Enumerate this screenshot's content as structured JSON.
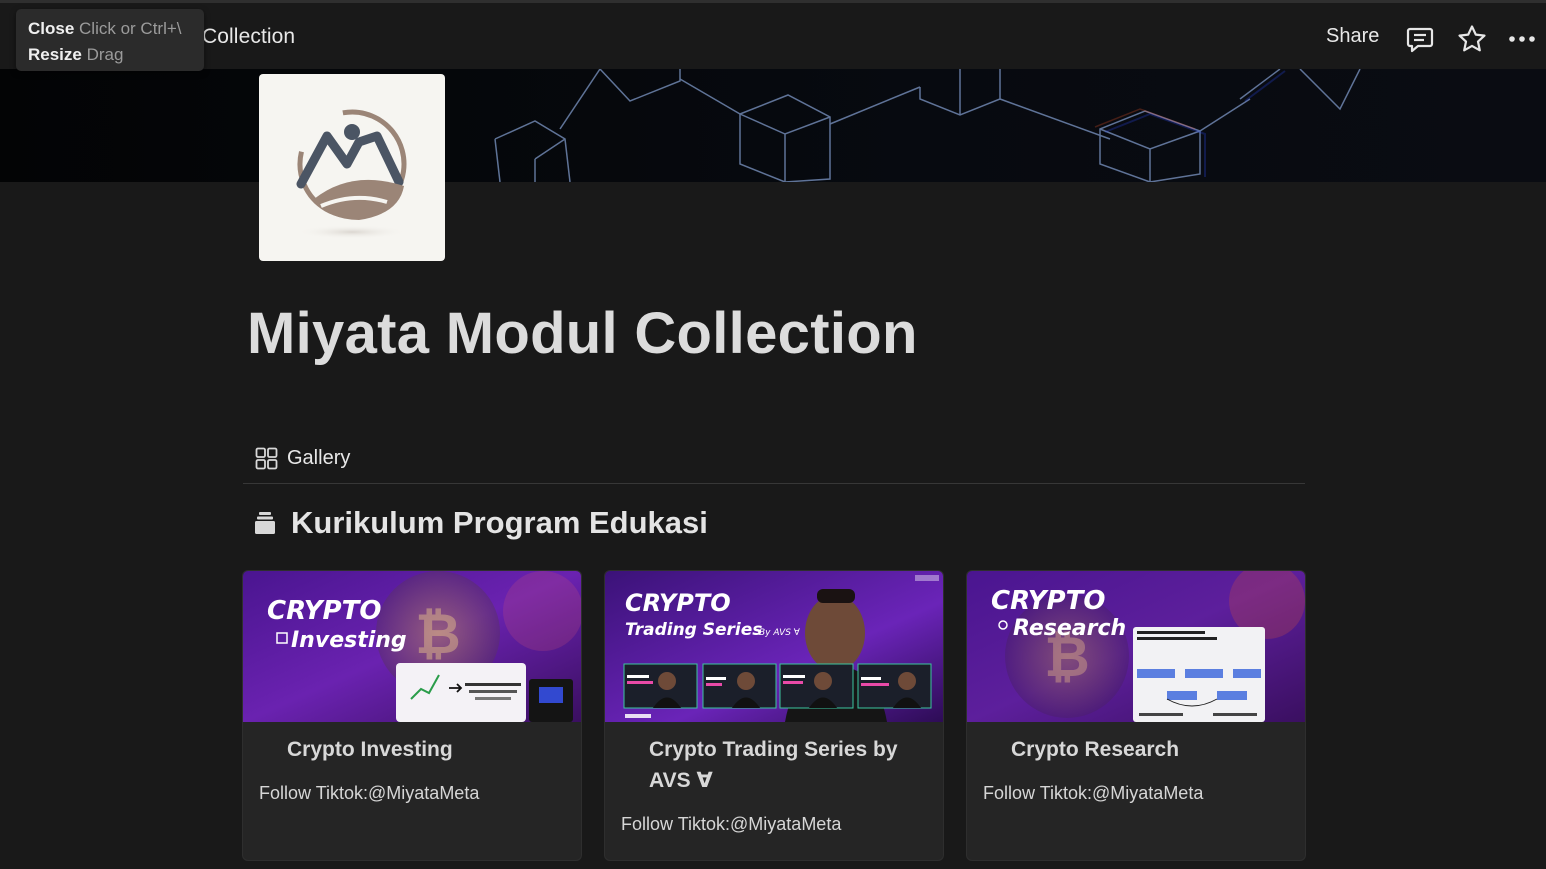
{
  "tooltip": {
    "close_key": "Close",
    "close_hint": "Click or Ctrl+\\",
    "resize_key": "Resize",
    "resize_hint": "Drag"
  },
  "topbar": {
    "breadcrumb_title": "Collection",
    "share_label": "Share",
    "icons": [
      "comment-icon",
      "star-icon",
      "more-icon"
    ]
  },
  "page": {
    "title": "Miyata Modul Collection"
  },
  "view": {
    "tab_label": "Gallery"
  },
  "group": {
    "heading": "Kurikulum Program Edukasi"
  },
  "cards": [
    {
      "title": "Crypto Investing",
      "property": "Follow Tiktok:@MiyataMeta",
      "thumb_line1": "CRYPTO",
      "thumb_line2": "Investing"
    },
    {
      "title": "Crypto Trading Series by AVS ∀",
      "property": "Follow Tiktok:@MiyataMeta",
      "thumb_line1": "CRYPTO",
      "thumb_line2": "Trading Series",
      "thumb_by": "By AVS ∀"
    },
    {
      "title": "Crypto Research",
      "property": "Follow Tiktok:@MiyataMeta",
      "thumb_line1": "CRYPTO",
      "thumb_line2": "Research"
    }
  ],
  "colors": {
    "background": "#191919",
    "card": "#252525",
    "thumb_purple": "#5b1a9e"
  }
}
